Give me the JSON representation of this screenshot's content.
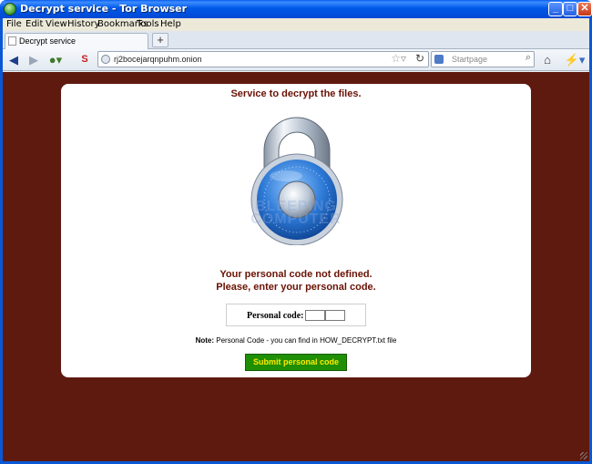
{
  "window": {
    "title": "Decrypt service - Tor Browser"
  },
  "menu": [
    "File",
    "Edit",
    "View",
    "History",
    "Bookmarks",
    "Tools",
    "Help"
  ],
  "tabs": [
    {
      "label": "Decrypt service"
    }
  ],
  "toolbar": {
    "new_tab": "+"
  },
  "address": {
    "url": "rj2bocejarqnpuhm.onion"
  },
  "search": {
    "placeholder": "Startpage"
  },
  "page": {
    "heading": "Service to decrypt the files.",
    "watermark_line1": "BLEEPING",
    "watermark_line2": "COMPUTER",
    "message_line1": "Your personal code not defined.",
    "message_line2": "Please, enter your personal code.",
    "code_label": "Personal code:",
    "note_bold": "Note:",
    "note_text": " Personal Code - you can find in HOW_DECRYPT.txt file",
    "submit_label": "Submit personal code"
  },
  "colors": {
    "background": "#5f1a10",
    "heading": "#6a1204",
    "submit_bg": "#1f8f06",
    "submit_text": "#ffea00"
  }
}
